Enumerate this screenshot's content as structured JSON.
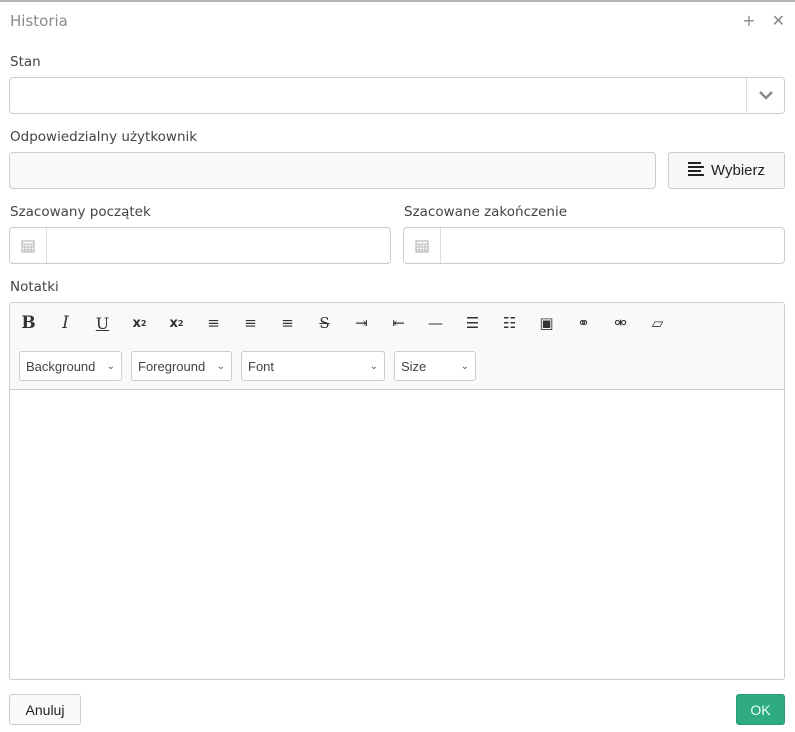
{
  "dialog": {
    "title": "Historia",
    "icons": [
      "plus-icon",
      "close-icon"
    ]
  },
  "fields": {
    "state": {
      "label": "Stan",
      "value": ""
    },
    "user": {
      "label": "Odpowiedzialny użytkownik",
      "value": "",
      "button": "Wybierz"
    },
    "start": {
      "label": "Szacowany początek",
      "value": ""
    },
    "end": {
      "label": "Szacowane zakończenie",
      "value": ""
    },
    "notes": {
      "label": "Notatki",
      "value": ""
    }
  },
  "toolbar": {
    "buttons": [
      "bold",
      "italic",
      "underline",
      "subscript",
      "superscript",
      "align-left",
      "align-center",
      "align-right",
      "strikethrough",
      "indent",
      "outdent",
      "horizontal-rule",
      "ordered-list",
      "unordered-list",
      "image",
      "link",
      "unlink",
      "eraser"
    ],
    "dropdowns": [
      "Background",
      "Foreground",
      "Font",
      "Size"
    ]
  },
  "footer": {
    "cancel": "Anuluj",
    "ok": "OK"
  },
  "colors": {
    "ok_button": "#2eab82"
  }
}
